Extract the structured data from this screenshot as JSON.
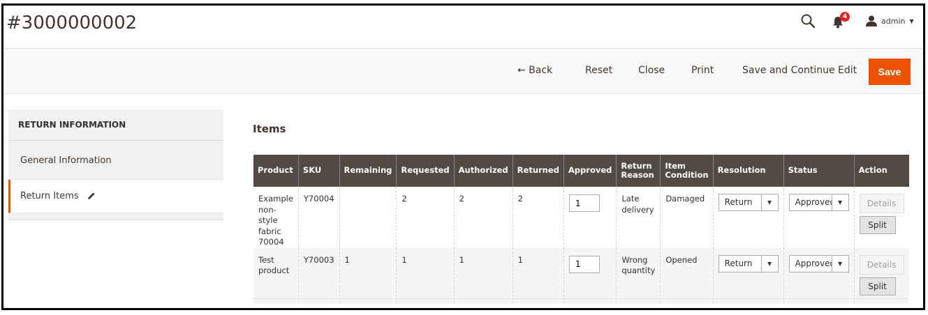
{
  "header": {
    "title": "#3000000002",
    "notifications_count": "4",
    "user_name": "admin"
  },
  "actions": {
    "back": "← Back",
    "reset": "Reset",
    "close": "Close",
    "print": "Print",
    "save_continue": "Save and Continue Edit",
    "save": "Save"
  },
  "sidebar": {
    "heading": "RETURN INFORMATION",
    "items": [
      {
        "label": "General Information"
      },
      {
        "label": "Return Items"
      }
    ]
  },
  "items_section": {
    "title": "Items",
    "columns": [
      "Product",
      "SKU",
      "Remaining",
      "Requested",
      "Authorized",
      "Returned",
      "Approved",
      "Return Reason",
      "Item Condition",
      "Resolution",
      "Status",
      "Action"
    ],
    "rows": [
      {
        "product": "Example non-style fabric 70004",
        "sku": "Y70004",
        "remaining": "",
        "requested": "2",
        "authorized": "2",
        "returned": "2",
        "approved": "1",
        "return_reason": "Late delivery",
        "item_condition": "Damaged",
        "resolution": "Return",
        "status": "Approved",
        "details_label": "Details",
        "split_label": "Split"
      },
      {
        "product": "Test product",
        "sku": "Y70003",
        "remaining": "1",
        "requested": "1",
        "authorized": "1",
        "returned": "1",
        "approved": "1",
        "return_reason": "Wrong quantity",
        "item_condition": "Opened",
        "resolution": "Return",
        "status": "Approved",
        "details_label": "Details",
        "split_label": "Split"
      }
    ]
  },
  "colors": {
    "accent": "#eb5202",
    "table_header": "#514943"
  },
  "icons": {
    "search": "search-icon",
    "notifications": "bell-icon",
    "user": "user-icon",
    "edit": "pencil-icon"
  }
}
